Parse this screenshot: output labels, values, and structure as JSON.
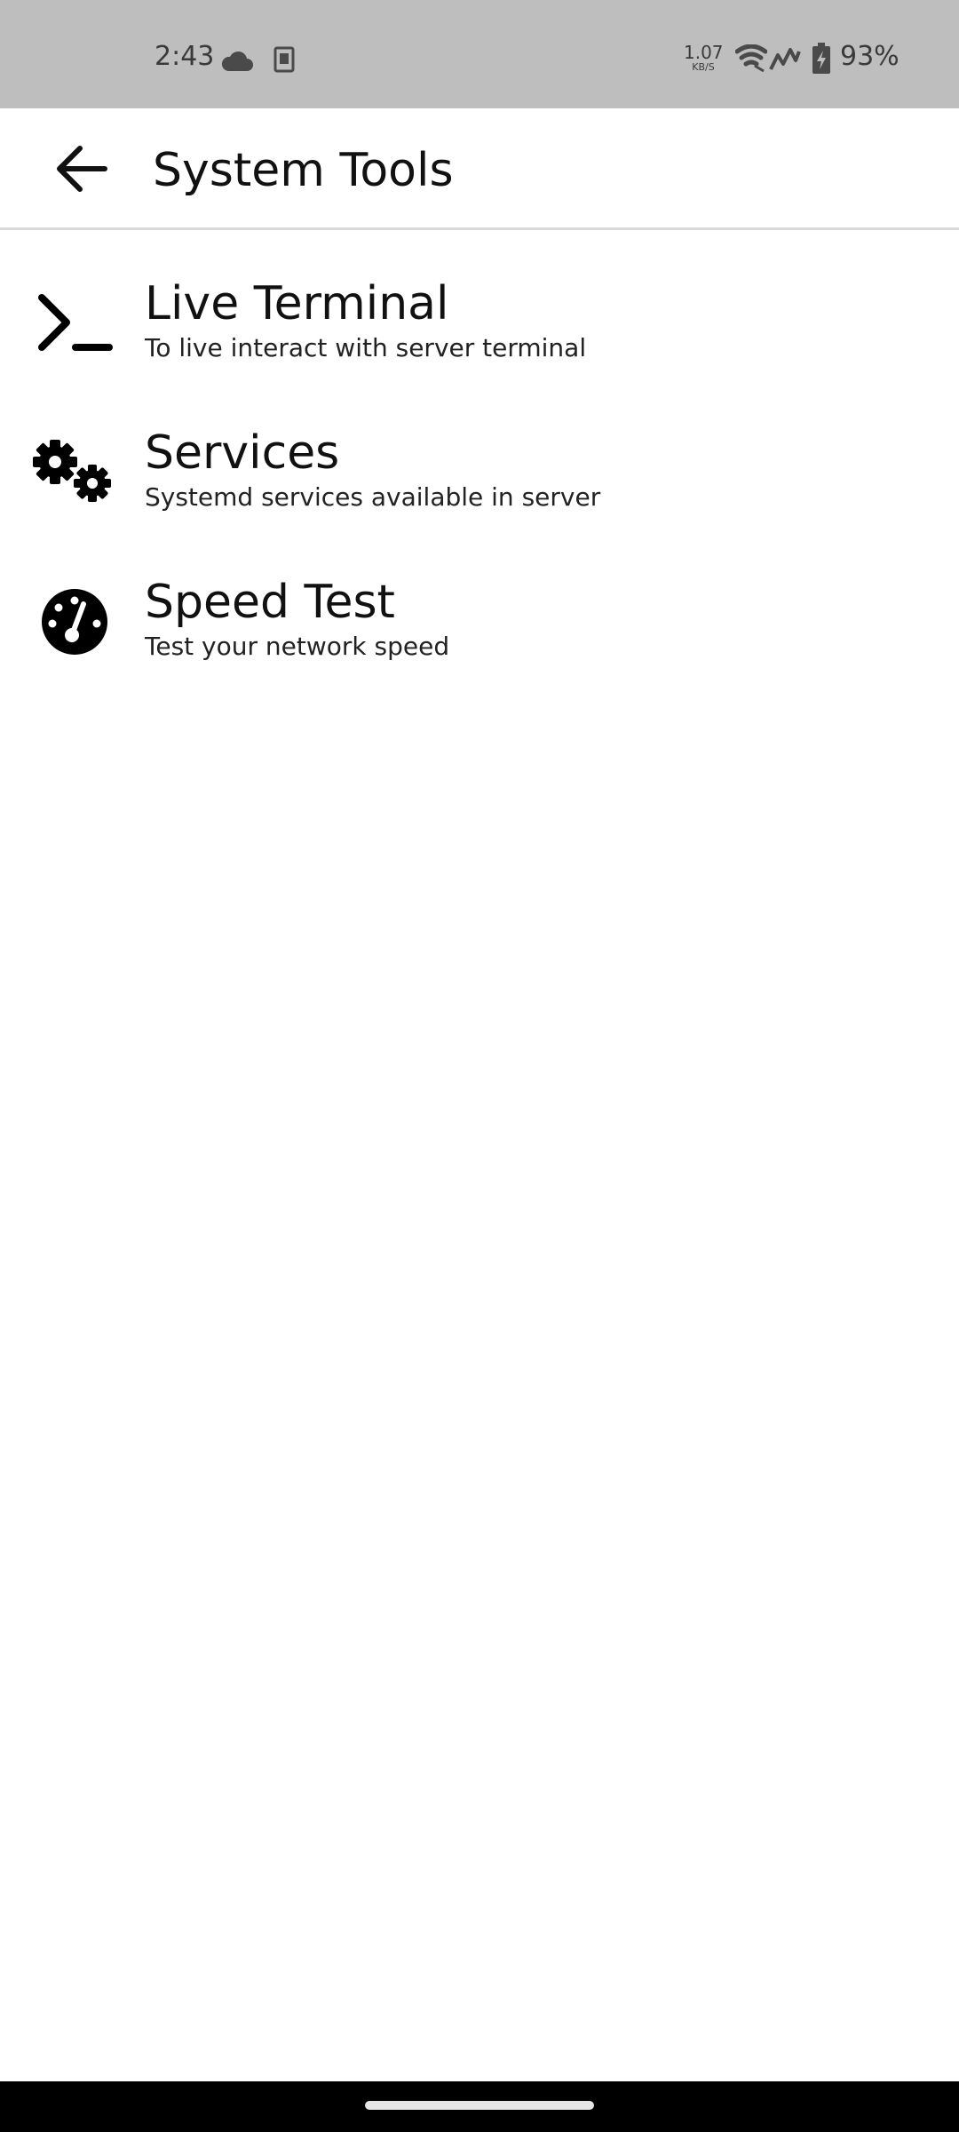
{
  "status_bar": {
    "time": "2:43",
    "net_speed_value": "1.07",
    "net_speed_unit": "KB/S",
    "battery_percent": "93%",
    "icons": [
      "cloud-icon",
      "sim-card-icon",
      "wifi-icon",
      "signal-icon",
      "battery-charging-icon"
    ]
  },
  "app_bar": {
    "back_icon": "arrow-left-icon",
    "title": "System Tools"
  },
  "tools": [
    {
      "icon": "terminal-icon",
      "title": "Live Terminal",
      "subtitle": "To live interact with server terminal"
    },
    {
      "icon": "gears-icon",
      "title": "Services",
      "subtitle": "Systemd services available in server"
    },
    {
      "icon": "speedometer-icon",
      "title": "Speed Test",
      "subtitle": "Test your network speed"
    }
  ],
  "colors": {
    "status_bar_bg": "#bebebe",
    "background": "#ffffff",
    "text": "#111111",
    "nav_bar": "#000000"
  }
}
